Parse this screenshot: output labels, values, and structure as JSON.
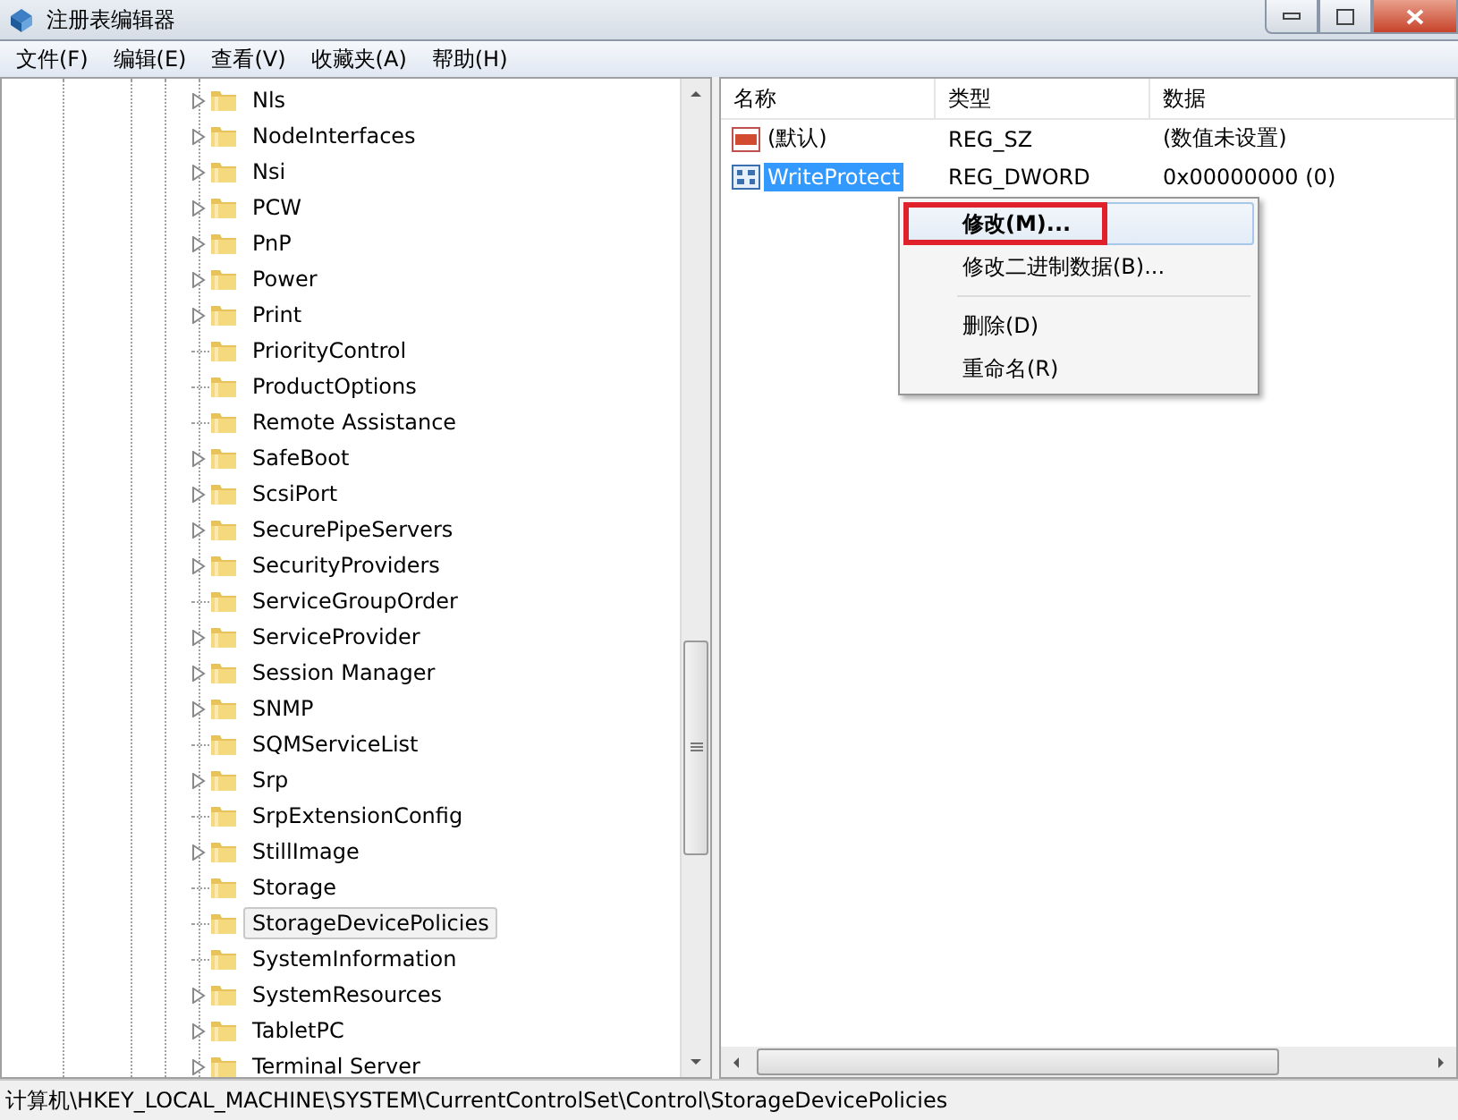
{
  "window": {
    "title": "注册表编辑器"
  },
  "menu": [
    "文件(F)",
    "编辑(E)",
    "查看(V)",
    "收藏夹(A)",
    "帮助(H)"
  ],
  "tree": {
    "items": [
      {
        "label": "Nls",
        "expandable": true,
        "selected": false
      },
      {
        "label": "NodeInterfaces",
        "expandable": true,
        "selected": false
      },
      {
        "label": "Nsi",
        "expandable": true,
        "selected": false
      },
      {
        "label": "PCW",
        "expandable": true,
        "selected": false
      },
      {
        "label": "PnP",
        "expandable": true,
        "selected": false
      },
      {
        "label": "Power",
        "expandable": true,
        "selected": false
      },
      {
        "label": "Print",
        "expandable": true,
        "selected": false
      },
      {
        "label": "PriorityControl",
        "expandable": false,
        "selected": false
      },
      {
        "label": "ProductOptions",
        "expandable": false,
        "selected": false
      },
      {
        "label": "Remote Assistance",
        "expandable": false,
        "selected": false
      },
      {
        "label": "SafeBoot",
        "expandable": true,
        "selected": false
      },
      {
        "label": "ScsiPort",
        "expandable": true,
        "selected": false
      },
      {
        "label": "SecurePipeServers",
        "expandable": true,
        "selected": false
      },
      {
        "label": "SecurityProviders",
        "expandable": true,
        "selected": false
      },
      {
        "label": "ServiceGroupOrder",
        "expandable": false,
        "selected": false
      },
      {
        "label": "ServiceProvider",
        "expandable": true,
        "selected": false
      },
      {
        "label": "Session Manager",
        "expandable": true,
        "selected": false
      },
      {
        "label": "SNMP",
        "expandable": true,
        "selected": false
      },
      {
        "label": "SQMServiceList",
        "expandable": false,
        "selected": false
      },
      {
        "label": "Srp",
        "expandable": true,
        "selected": false
      },
      {
        "label": "SrpExtensionConfig",
        "expandable": false,
        "selected": false
      },
      {
        "label": "StillImage",
        "expandable": true,
        "selected": false
      },
      {
        "label": "Storage",
        "expandable": false,
        "selected": false
      },
      {
        "label": "StorageDevicePolicies",
        "expandable": false,
        "selected": true
      },
      {
        "label": "SystemInformation",
        "expandable": false,
        "selected": false
      },
      {
        "label": "SystemResources",
        "expandable": true,
        "selected": false
      },
      {
        "label": "TabletPC",
        "expandable": true,
        "selected": false
      },
      {
        "label": "Terminal Server",
        "expandable": true,
        "selected": false
      }
    ]
  },
  "values": {
    "columns": [
      "名称",
      "类型",
      "数据"
    ],
    "rows": [
      {
        "kind": "string",
        "name": "(默认)",
        "type": "REG_SZ",
        "data": "(数值未设置)",
        "selected": false
      },
      {
        "kind": "binary",
        "name": "WriteProtect",
        "type": "REG_DWORD",
        "data": "0x00000000 (0)",
        "selected": true
      }
    ]
  },
  "context_menu": {
    "groups": [
      [
        {
          "label": "修改(M)...",
          "highlighted": true
        },
        {
          "label": "修改二进制数据(B)...",
          "highlighted": false
        }
      ],
      [
        {
          "label": "删除(D)",
          "highlighted": false
        },
        {
          "label": "重命名(R)",
          "highlighted": false
        }
      ]
    ]
  },
  "status_bar": "计算机\\HKEY_LOCAL_MACHINE\\SYSTEM\\CurrentControlSet\\Control\\StorageDevicePolicies"
}
